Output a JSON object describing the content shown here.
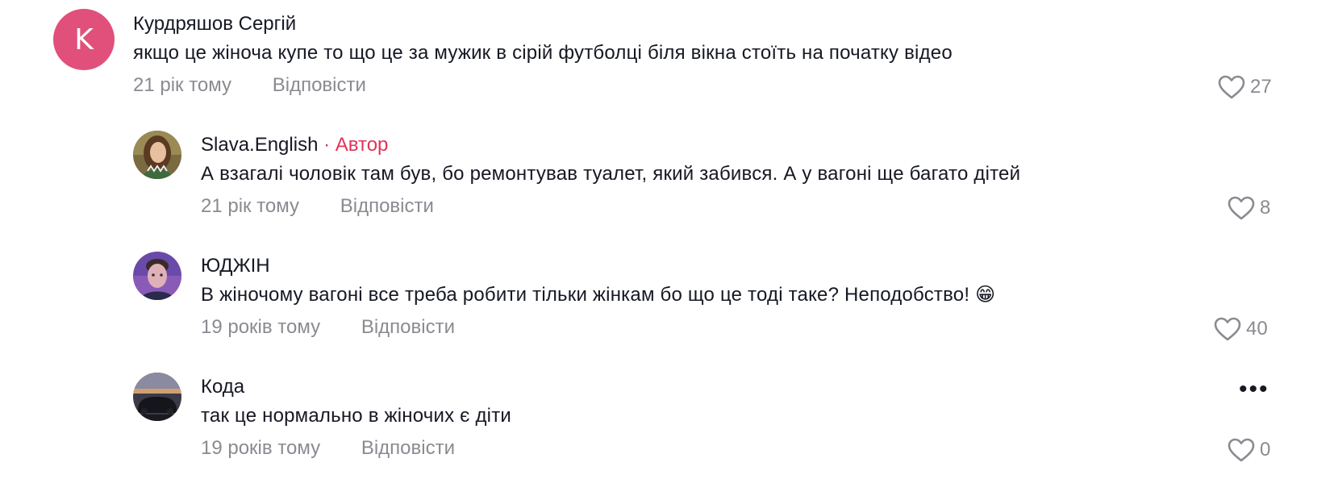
{
  "comments": [
    {
      "avatar_letter": "K",
      "name": "Курдряшов Сергій",
      "author_tag": "",
      "text": "якщо це жіноча купе то що це за мужик в сірій футболці біля вікна стоїть на початку відео",
      "time": "21 рік тому",
      "reply_label": "Відповісти",
      "likes": "27",
      "icon": "heart-icon"
    },
    {
      "avatar_icon": "woman-avatar",
      "name": "Slava.English",
      "author_tag": " · Автор",
      "text": "А взагалі чоловік там був, бо ремонтував туалет, який забився. А у вагоні ще багато дітей",
      "time": "21 рік тому",
      "reply_label": "Відповісти",
      "likes": "8",
      "icon": "heart-icon"
    },
    {
      "avatar_icon": "man-avatar",
      "name": "ЮДЖІН",
      "author_tag": "",
      "text": "В жіночому вагоні все треба робити тільки жінкам бо що це тоді таке? Неподобство! 😁",
      "time": "19 років тому",
      "reply_label": "Відповісти",
      "likes": "40",
      "icon": "heart-icon"
    },
    {
      "avatar_icon": "car-avatar",
      "name": "Кода",
      "author_tag": "",
      "text": "так це нормально в жіночих є діти",
      "time": "19 років тому",
      "reply_label": "Відповісти",
      "likes": "0",
      "icon": "heart-icon",
      "more_label": "•••"
    }
  ],
  "colors": {
    "avatar_bg": "#e0507a",
    "author_accent": "#e0355a",
    "muted": "#8a8b91"
  }
}
